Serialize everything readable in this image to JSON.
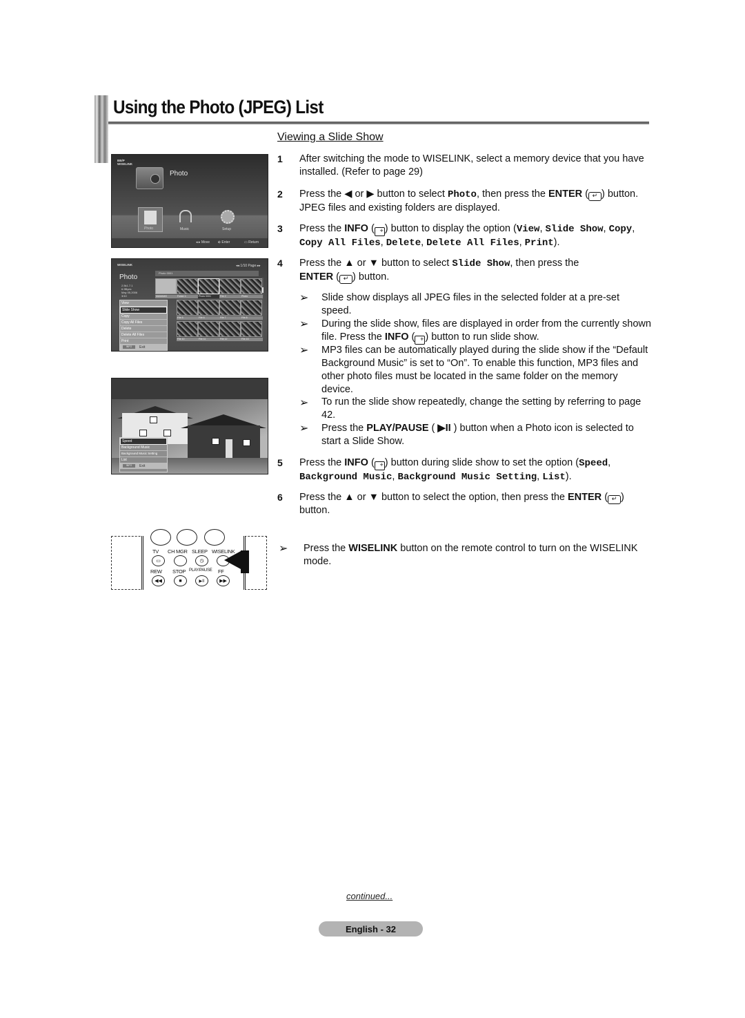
{
  "page": {
    "title": "Using the Photo (JPEG) List",
    "section_title": "Viewing a Slide Show",
    "continued": "continued...",
    "footer_badge": "English - 32"
  },
  "screens": {
    "main_menu": {
      "brand": "WISELINK",
      "brand_small": "BB/P",
      "heading": "Photo",
      "tabs": [
        {
          "label": "Photo",
          "icon": "photo-camera-icon",
          "selected": true
        },
        {
          "label": "Music",
          "icon": "headphones-icon",
          "selected": false
        },
        {
          "label": "Setup",
          "icon": "gear-icon",
          "selected": false
        }
      ],
      "nav": [
        {
          "icon": "left-right-arrows-icon",
          "label": "Move"
        },
        {
          "icon": "enter-icon",
          "label": "Enter"
        },
        {
          "icon": "return-icon",
          "label": "Return"
        }
      ]
    },
    "photo_list": {
      "brand": "WISELINK",
      "heading": "Photo",
      "page_indicator": "1/10 Page",
      "path": "Photo 0001",
      "info_lines": [
        "2.5k1.7.1",
        "6.9Byes",
        "May 05,2006",
        "3/10"
      ],
      "thumb_labels": [
        "MAMAMG",
        "Folder 1",
        "Photo 0001",
        "File 2",
        "Photo",
        "File 5",
        "File 6",
        "File 7",
        "File 8",
        "File 10",
        "File 11",
        "File 12",
        "File 13"
      ],
      "menu": [
        "View",
        "Slide Show",
        "Copy",
        "Copy All Files",
        "Delete",
        "Delete All Files",
        "Print"
      ],
      "menu_selected": "Slide Show",
      "exit_key": "INFO",
      "exit_label": "Exit"
    },
    "slideshow": {
      "menu": [
        "Speed",
        "Background Music",
        "Background Music Setting",
        "List"
      ],
      "menu_selected": "Speed",
      "exit_key": "INFO",
      "exit_label": "Exit"
    },
    "remote": {
      "labels_row1": [
        "TV",
        "CH MGR",
        "SLEEP",
        "WISELINK"
      ],
      "labels_row2": [
        "REW",
        "STOP",
        "PLAY/PAUSE",
        "FF"
      ],
      "buttons_row2_glyphs": [
        "◀◀",
        "■",
        "▶II",
        "▶▶"
      ]
    }
  },
  "steps": [
    {
      "num": "1",
      "text": "After switching the mode to WISELINK, select a memory device that you have installed. (Refer to page 29)"
    },
    {
      "num": "2",
      "pre": "Press the ◀ or ▶ button to select ",
      "code": "Photo",
      "mid": ", then press the ",
      "bold": "ENTER",
      "post": " button. JPEG files and existing folders are displayed."
    },
    {
      "num": "3",
      "pre": "Press the ",
      "bold": "INFO",
      "post": " button to display the option (",
      "options": [
        "View",
        "Slide Show",
        "Copy",
        "Copy All Files",
        "Delete",
        "Delete All Files",
        "Print"
      ],
      "end": ")."
    },
    {
      "num": "4",
      "pre": "Press the ▲ or ▼ button to select ",
      "code": "Slide Show",
      "mid": ", then press the",
      "bold": "ENTER",
      "post": " button."
    },
    {
      "num": "5",
      "pre": "Press the ",
      "bold": "INFO",
      "post": " button during slide show to set the option (",
      "options": [
        "Speed",
        "Background Music",
        "Background Music Setting",
        "List"
      ],
      "end": ")."
    },
    {
      "num": "6",
      "pre": "Press the ▲ or ▼ button to select the option, then press the ",
      "bold": "ENTER",
      "post": " button."
    }
  ],
  "notes": [
    {
      "text": "Slide show displays all JPEG files in the selected folder at a pre-set speed."
    },
    {
      "pre": "During the slide show, files are displayed in order from the currently shown file. Press the ",
      "bold": "INFO",
      "post": " button to run slide show."
    },
    {
      "text": "MP3 files can be automatically played during the slide show if the “Default Background Music” is set to “On”. To enable this function, MP3 files and other photo files must be located in the same folder on the memory device."
    },
    {
      "text": "To run the slide show repeatedly, change the setting by referring to page 42."
    },
    {
      "pre": "Press the ",
      "bold": "PLAY/PAUSE",
      "glyph": "▶II",
      "post": " button when a Photo icon is selected to start a Slide Show."
    }
  ],
  "final_note": {
    "pre": "Press the ",
    "bold": "WISELINK",
    "post": " button on the remote control to turn on the WISELINK mode."
  },
  "glyphs": {
    "arrow": "➢",
    "enter": "↵",
    "info": "+"
  }
}
